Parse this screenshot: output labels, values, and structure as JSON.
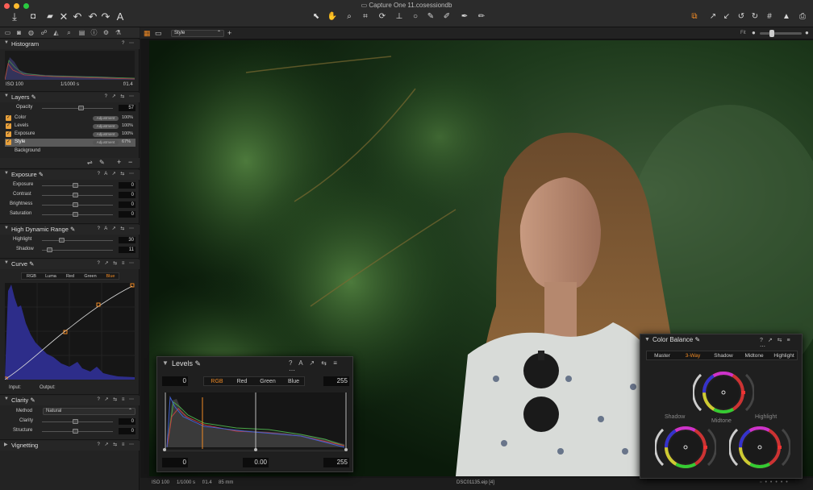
{
  "window": {
    "title": "Capture One 11.cosessiondb"
  },
  "toolbar": {
    "left_icons": [
      "import-icon",
      "camera-icon",
      "folder-icon",
      "delete-icon",
      "undo-history-icon",
      "undo-icon",
      "redo-icon",
      "text-icon"
    ],
    "center_icons": [
      "select-cursor-icon",
      "pan-hand-icon",
      "loupe-icon",
      "crop-icon",
      "rotate-icon",
      "keystone-icon",
      "circle-mask-icon",
      "brush-icon",
      "eraser-icon",
      "picker-icon",
      "annotate-icon"
    ],
    "right_icons": [
      "copy-apply-icon",
      "expand-icon",
      "contract-icon",
      "rotate-left-icon",
      "rotate-right-icon",
      "grid-icon",
      "warning-icon",
      "print-icon"
    ]
  },
  "viewer_bar": {
    "style_select": "Style",
    "fit_label": "Fit"
  },
  "histogram": {
    "title": "Histogram",
    "iso": "ISO 100",
    "shutter": "1/1000 s",
    "aperture": "f/1.4"
  },
  "layers": {
    "title": "Layers",
    "opacity_label": "Opacity",
    "opacity_value": "57",
    "items": [
      {
        "name": "Color",
        "badge": "Adjustment",
        "pct": "100%"
      },
      {
        "name": "Levels",
        "badge": "Adjustment",
        "pct": "100%"
      },
      {
        "name": "Exposure",
        "badge": "Adjustment",
        "pct": "100%"
      },
      {
        "name": "Style",
        "badge": "Adjustment",
        "pct": "67%"
      }
    ],
    "background": "Background"
  },
  "exposure": {
    "title": "Exposure",
    "rows": [
      {
        "label": "Exposure",
        "value": "0"
      },
      {
        "label": "Contrast",
        "value": "0"
      },
      {
        "label": "Brightness",
        "value": "0"
      },
      {
        "label": "Saturation",
        "value": "0"
      }
    ]
  },
  "hdr": {
    "title": "High Dynamic Range",
    "rows": [
      {
        "label": "Highlight",
        "value": "30"
      },
      {
        "label": "Shadow",
        "value": "11"
      }
    ]
  },
  "curve": {
    "title": "Curve",
    "tabs": [
      "RGB",
      "Luma",
      "Red",
      "Green",
      "Blue"
    ],
    "active_tab": "Blue",
    "input_label": "Input:",
    "output_label": "Output:"
  },
  "clarity": {
    "title": "Clarity",
    "method_label": "Method",
    "method_value": "Natural",
    "rows": [
      {
        "label": "Clarity",
        "value": "0"
      },
      {
        "label": "Structure",
        "value": "0"
      }
    ]
  },
  "vignetting": {
    "title": "Vignetting"
  },
  "levels": {
    "title": "Levels",
    "tabs": [
      "RGB",
      "Red",
      "Green",
      "Blue"
    ],
    "active_tab": "RGB",
    "input_low": "0",
    "input_high": "255",
    "output_low": "0",
    "midpoint": "0.00",
    "output_high": "255"
  },
  "color_balance": {
    "title": "Color Balance",
    "tabs": [
      "Master",
      "3-Way",
      "Shadow",
      "Midtone",
      "Highlight"
    ],
    "active_tab": "3-Way",
    "shadow": "Shadow",
    "midtone": "Midtone",
    "highlight": "Highlight"
  },
  "status": {
    "iso": "ISO 100",
    "shutter": "1/1000 s",
    "aperture": "f/1.4",
    "focal": "85 mm",
    "filename": "DSC01135.eip [4]"
  },
  "colors": {
    "accent": "#f08a24",
    "panel": "#232323",
    "background": "#1e1e1e"
  }
}
